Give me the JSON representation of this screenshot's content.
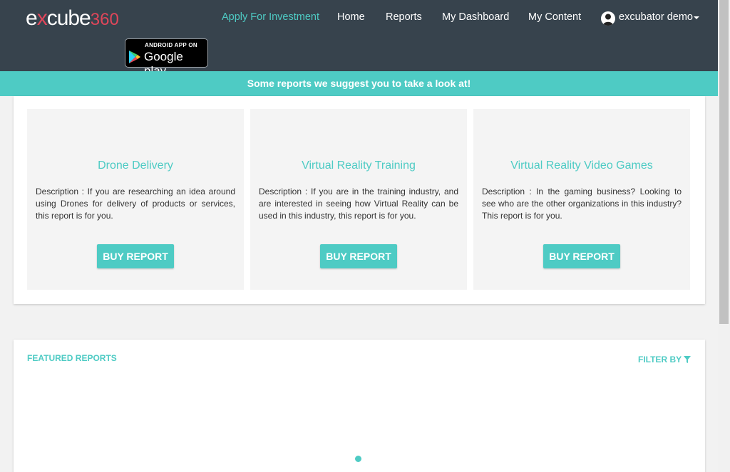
{
  "header": {
    "logo": {
      "prefix": "e",
      "x": "x",
      "rest": "cube",
      "num": "360"
    },
    "gplay": {
      "small": "ANDROID APP ON",
      "big": "Google play"
    },
    "nav": [
      {
        "label": "Apply For Investment",
        "active": true
      },
      {
        "label": "Home"
      },
      {
        "label": "Reports"
      },
      {
        "label": "My Dashboard"
      },
      {
        "label": "My Content"
      }
    ],
    "user": {
      "name": "excubator demo"
    }
  },
  "banner": {
    "text": "Some reports we suggest you to take a look at!"
  },
  "suggestions": [
    {
      "title": "Drone Delivery",
      "description": "Description : If you are researching an idea around using Drones for delivery of products or services, this report is for you.",
      "button": "BUY REPORT"
    },
    {
      "title": "Virtual Reality Training",
      "description": "Description : If you are in the training industry, and are interested in seeing how Virtual Reality can be used in this industry, this report is for you.",
      "button": "BUY REPORT"
    },
    {
      "title": "Virtual Reality Video Games",
      "description": "Description : In the gaming business? Looking to see who are the other organizations in this industry? This report is for you.",
      "button": "BUY REPORT"
    }
  ],
  "featured": {
    "title": "FEATURED REPORTS",
    "filter_label": "FILTER BY"
  },
  "colors": {
    "accent": "#4ecbc4",
    "header_bg": "#37434d",
    "logo_accent": "#e0465a"
  }
}
